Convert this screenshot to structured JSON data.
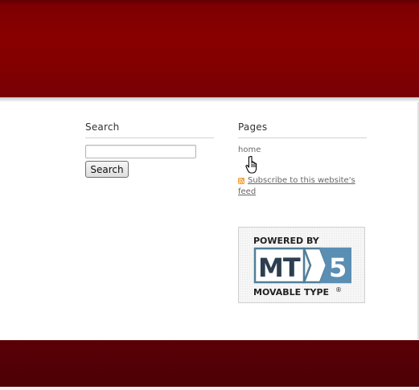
{
  "search_widget": {
    "title": "Search",
    "input_value": "",
    "button_label": "Search"
  },
  "pages_widget": {
    "title": "Pages",
    "links": [
      "home"
    ]
  },
  "feed": {
    "label": "Subscribe to this website's feed",
    "icon": "rss-feed-icon"
  },
  "badge": {
    "line1": "POWERED BY",
    "logo_left": "MT",
    "logo_right": "5",
    "line2": "MOVABLE TYPE",
    "mark": "®"
  },
  "colors": {
    "header": "#860000",
    "footer": "#4f0005",
    "badge_blue": "#5a8eb3",
    "badge_dark": "#2c3e50"
  }
}
